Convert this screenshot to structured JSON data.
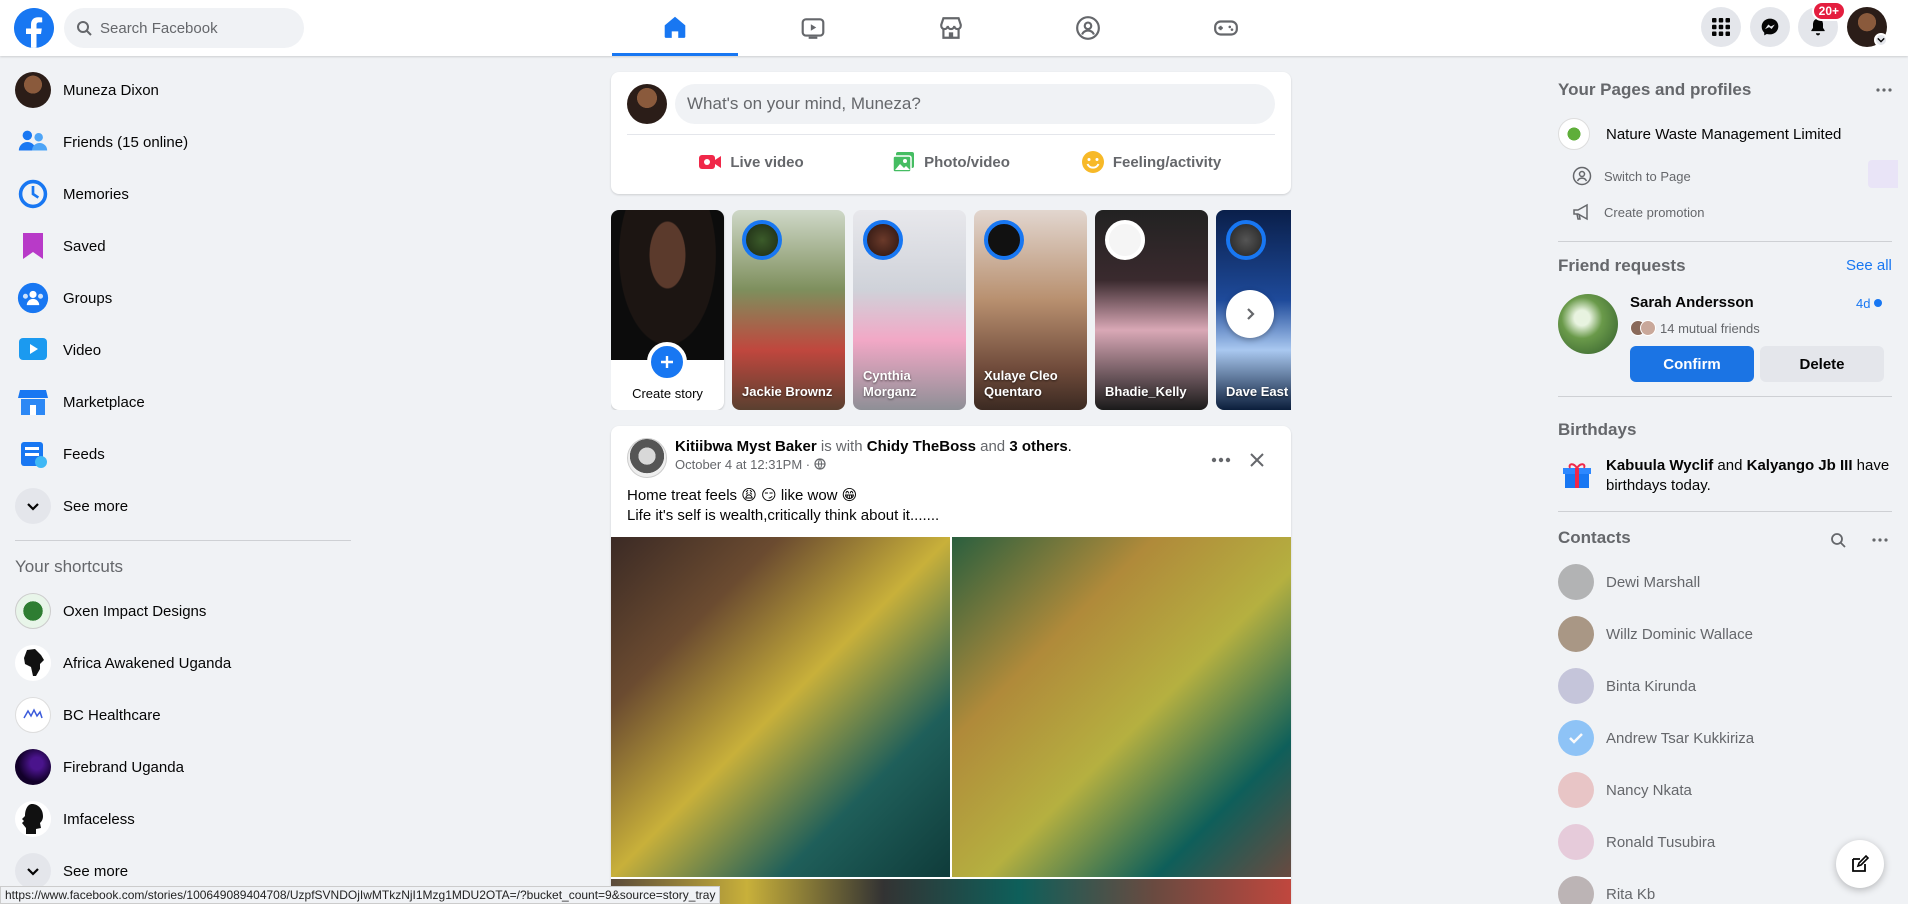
{
  "header": {
    "search_placeholder": "Search Facebook",
    "notification_count": "20+"
  },
  "sidebar": {
    "items": [
      {
        "label": "Muneza Dixon",
        "icon": "profile-avatar"
      },
      {
        "label": "Friends (15 online)",
        "icon": "friends-icon"
      },
      {
        "label": "Memories",
        "icon": "memories-icon"
      },
      {
        "label": "Saved",
        "icon": "saved-icon"
      },
      {
        "label": "Groups",
        "icon": "groups-icon"
      },
      {
        "label": "Video",
        "icon": "video-icon"
      },
      {
        "label": "Marketplace",
        "icon": "marketplace-icon"
      },
      {
        "label": "Feeds",
        "icon": "feeds-icon"
      },
      {
        "label": "See more",
        "icon": "chevron-down-icon"
      }
    ],
    "shortcuts_title": "Your shortcuts",
    "shortcuts": [
      {
        "label": "Oxen Impact Designs"
      },
      {
        "label": "Africa Awakened Uganda"
      },
      {
        "label": "BC Healthcare"
      },
      {
        "label": "Firebrand Uganda"
      },
      {
        "label": "Imfaceless"
      },
      {
        "label": "See more"
      }
    ]
  },
  "composer": {
    "placeholder": "What's on your mind, Muneza?",
    "actions": [
      "Live video",
      "Photo/video",
      "Feeling/activity"
    ]
  },
  "stories": [
    {
      "name": "Create story"
    },
    {
      "name": "Jackie Brownz"
    },
    {
      "name": "Cynthia Morganz"
    },
    {
      "name": "Xulaye Cleo Quentaro"
    },
    {
      "name": "Bhadie_Kelly"
    },
    {
      "name": "Dave East"
    }
  ],
  "post": {
    "author": "Kitiibwa Myst Baker",
    "with_text": "is with",
    "tagged": "Chidy TheBoss",
    "and_text": "and",
    "others": "3 others",
    "time": "October 4 at 12:31PM ·",
    "line1": "Home treat feels 😩 😏 like wow 😁",
    "line2": "Life it's self is wealth,critically think about it......."
  },
  "right": {
    "pages_title": "Your Pages and profiles",
    "page_name": "Nature Waste Management Limited",
    "switch_label": "Switch to Page",
    "promo_label": "Create promotion",
    "requests_title": "Friend requests",
    "see_all": "See all",
    "request_name": "Sarah Andersson",
    "request_time": "4d",
    "mutual": "14 mutual friends",
    "confirm": "Confirm",
    "delete": "Delete",
    "birthdays_title": "Birthdays",
    "bday_name1": "Kabuula Wyclif",
    "bday_and": "and",
    "bday_name2": "Kalyango Jb III",
    "bday_rest": "have birthdays today.",
    "contacts_title": "Contacts",
    "contacts": [
      "Dewi Marshall",
      "Willz Dominic Wallace",
      "Binta Kirunda",
      "Andrew Tsar Kukkiriza",
      "Nancy Nkata",
      "Ronald Tusubira",
      "Rita Kb"
    ]
  },
  "status_url": "https://www.facebook.com/stories/100649089404708/UzpfSVNDOjIwMTkzNjI1Mzg1MDU2OTA=/?bucket_count=9&source=story_tray",
  "colors": {
    "brand": "#1877f2",
    "background": "#f0f2f5",
    "badge": "#e41e3f"
  }
}
